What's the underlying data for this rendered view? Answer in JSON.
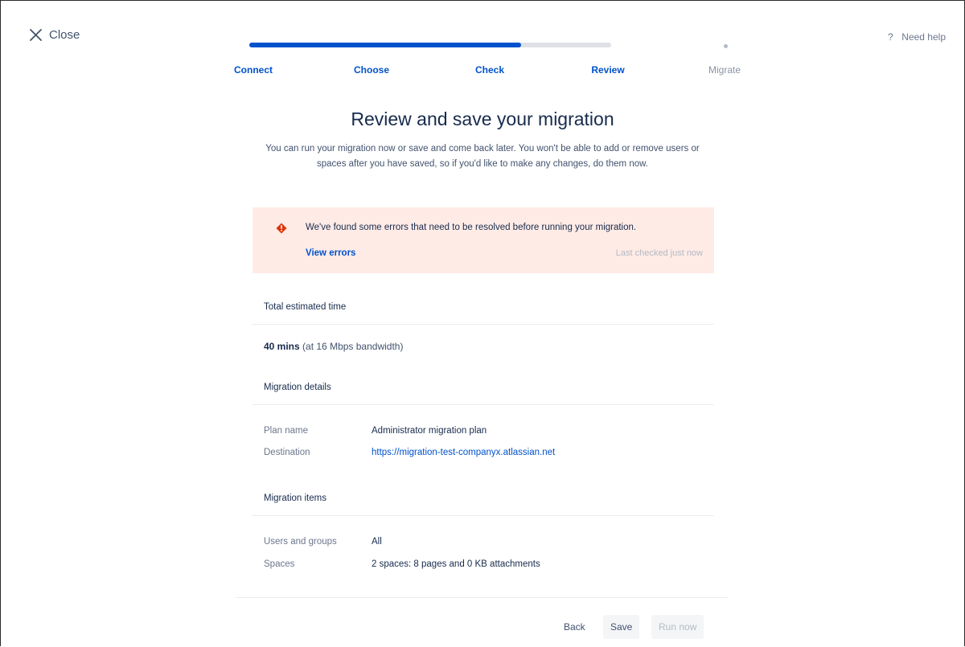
{
  "header": {
    "close_label": "Close",
    "help_label": "Need help",
    "help_icon": "?"
  },
  "progress": {
    "fraction_complete": 0.75,
    "steps": [
      {
        "label": "Connect",
        "state": "done"
      },
      {
        "label": "Choose",
        "state": "done"
      },
      {
        "label": "Check",
        "state": "done"
      },
      {
        "label": "Review",
        "state": "current"
      },
      {
        "label": "Migrate",
        "state": "upcoming"
      }
    ]
  },
  "main": {
    "title": "Review and save your migration",
    "subtitle": "You can run your migration now or save and come back later. You won't be able to add or remove users or spaces after you have saved, so if you'd like to make any changes, do them now."
  },
  "error_banner": {
    "message": "We've found some errors that need to be resolved before running your migration.",
    "view_errors_label": "View errors",
    "last_checked": "Last checked just now"
  },
  "estimated_time": {
    "heading": "Total estimated time",
    "duration": "40 mins",
    "bandwidth_note": "(at 16 Mbps bandwidth)"
  },
  "migration_details": {
    "heading": "Migration details",
    "rows": [
      {
        "label": "Plan name",
        "value": "Administrator migration plan"
      },
      {
        "label": "Destination",
        "value": "https://migration-test-companyx.atlassian.net"
      }
    ]
  },
  "migration_items": {
    "heading": "Migration items",
    "rows": [
      {
        "label": "Users and groups",
        "value": "All"
      },
      {
        "label": "Spaces",
        "value": "2 spaces:  8 pages and 0 KB attachments"
      }
    ]
  },
  "footer": {
    "back_label": "Back",
    "save_label": "Save",
    "run_label": "Run now"
  },
  "colors": {
    "primary": "#0052CC",
    "text": "#172B4D",
    "subtle_text": "#6B778C",
    "error_background": "#FFEBE6",
    "error_icon": "#DE350B",
    "track": "#DFE1E6"
  }
}
